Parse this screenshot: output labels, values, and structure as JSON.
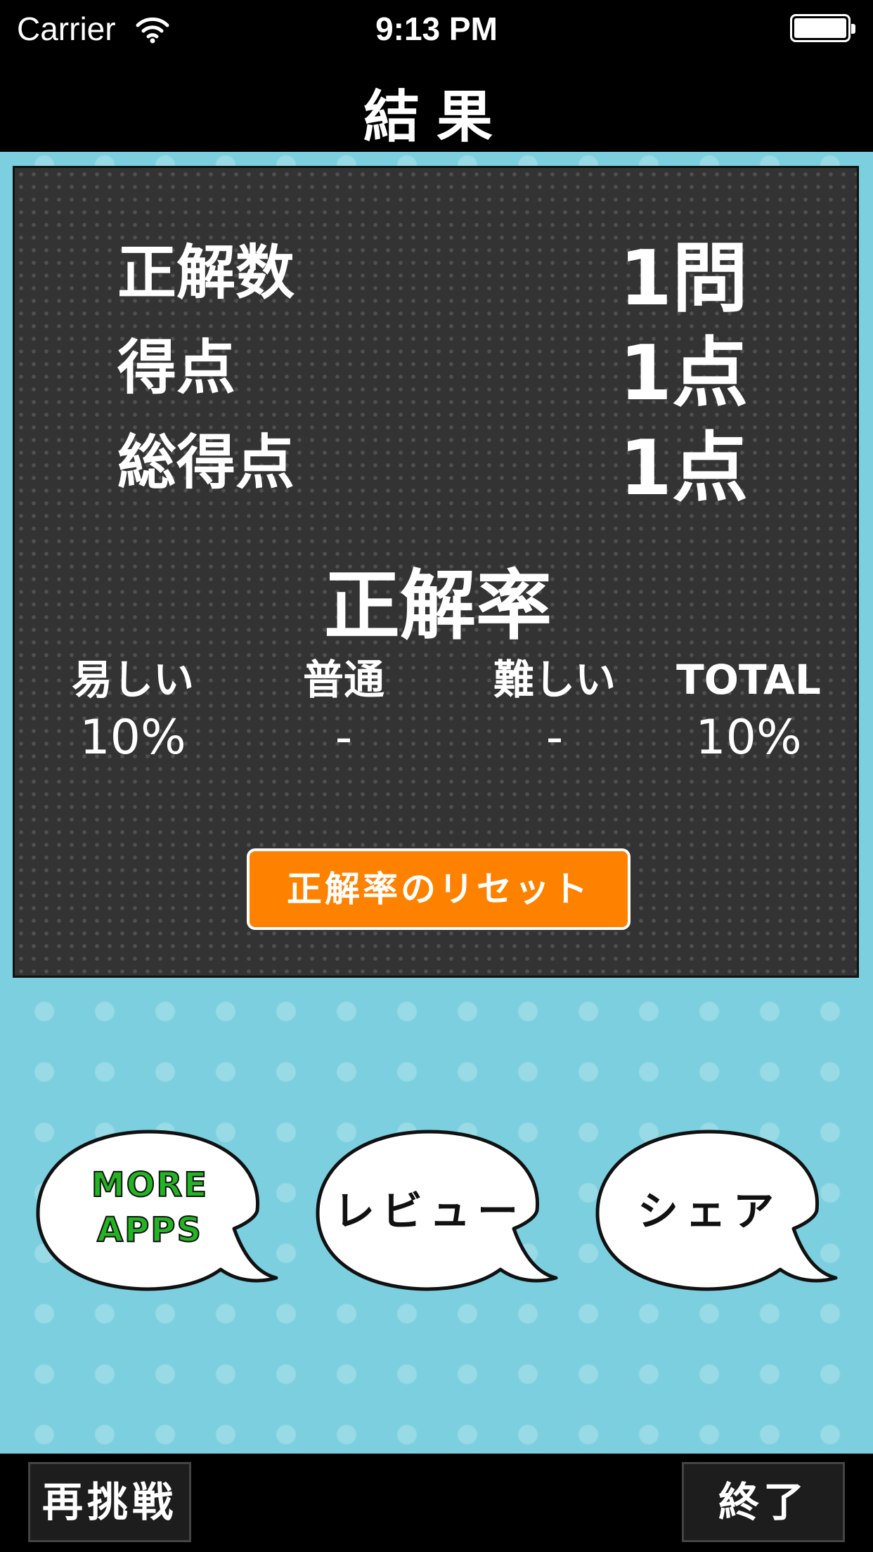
{
  "status_bar": {
    "carrier": "Carrier",
    "time": "9:13 PM",
    "wifi_icon": "wifi-icon",
    "battery_icon": "battery-icon"
  },
  "nav": {
    "title": "結果"
  },
  "results": {
    "stats": [
      {
        "label": "正解数",
        "value": "1問"
      },
      {
        "label": "得点",
        "value": "1点"
      },
      {
        "label": "総得点",
        "value": "1点"
      }
    ],
    "rate_title": "正解率",
    "rates": [
      {
        "label": "易しい",
        "value": "10%"
      },
      {
        "label": "普通",
        "value": "-"
      },
      {
        "label": "難しい",
        "value": "-"
      },
      {
        "label": "TOTAL",
        "value": "10%"
      }
    ],
    "reset_label": "正解率のリセット"
  },
  "bubbles": {
    "more_apps": "MORE\nAPPS",
    "review": "レビュー",
    "share": "シェア"
  },
  "toolbar": {
    "retry_label": "再挑戦",
    "exit_label": "終了"
  },
  "colors": {
    "background": "#7bcfdf",
    "panel": "#333333",
    "accent": "#ff8100",
    "more_apps_green": "#23b423"
  }
}
